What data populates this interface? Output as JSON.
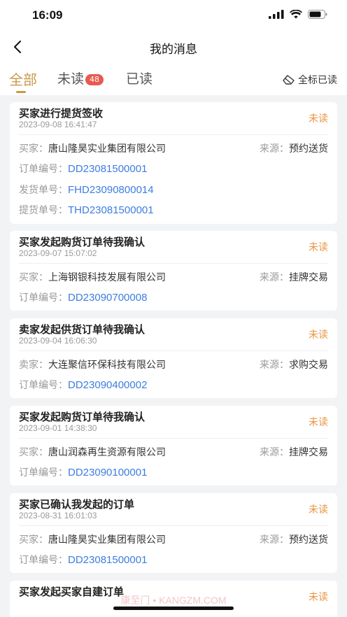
{
  "status_bar": {
    "time": "16:09"
  },
  "nav": {
    "title": "我的消息"
  },
  "tabs": {
    "all": "全部",
    "unread": "未读",
    "unread_count": "48",
    "read": "已读",
    "mark_all": "全标已读"
  },
  "labels": {
    "buyer": "买家：",
    "seller": "卖家：",
    "source": "来源：",
    "order_no": "订单编号：",
    "ship_no": "发货单号：",
    "pickup_no": "提货单号："
  },
  "messages": [
    {
      "title": "买家进行提货签收",
      "time": "2023-09-08 16:41:47",
      "status": "未读",
      "party": "唐山隆昊实业集团有限公司",
      "source": "预约送货",
      "order_no": "DD23081500001",
      "ship_no": "FHD23090800014",
      "pickup_no": "THD23081500001"
    },
    {
      "title": "买家发起购货订单待我确认",
      "time": "2023-09-07 15:07:02",
      "status": "未读",
      "party": "上海钢银科技发展有限公司",
      "source": "挂牌交易",
      "order_no": "DD23090700008"
    },
    {
      "title": "卖家发起供货订单待我确认",
      "time": "2023-09-04 16:06:30",
      "status": "未读",
      "party": "大连聚信环保科技有限公司",
      "source": "求购交易",
      "order_no": "DD23090400002"
    },
    {
      "title": "买家发起购货订单待我确认",
      "time": "2023-09-01 14:38:30",
      "status": "未读",
      "party": "唐山润森再生资源有限公司",
      "source": "挂牌交易",
      "order_no": "DD23090100001"
    },
    {
      "title": "买家已确认我发起的订单",
      "time": "2023-08-31 16:01:03",
      "status": "未读",
      "party": "唐山隆昊实业集团有限公司",
      "source": "预约送货",
      "order_no": "DD23081500001"
    },
    {
      "title": "买家发起买家自建订单",
      "status": "未读"
    }
  ],
  "watermark": "康至门 • KANGZM.COM"
}
